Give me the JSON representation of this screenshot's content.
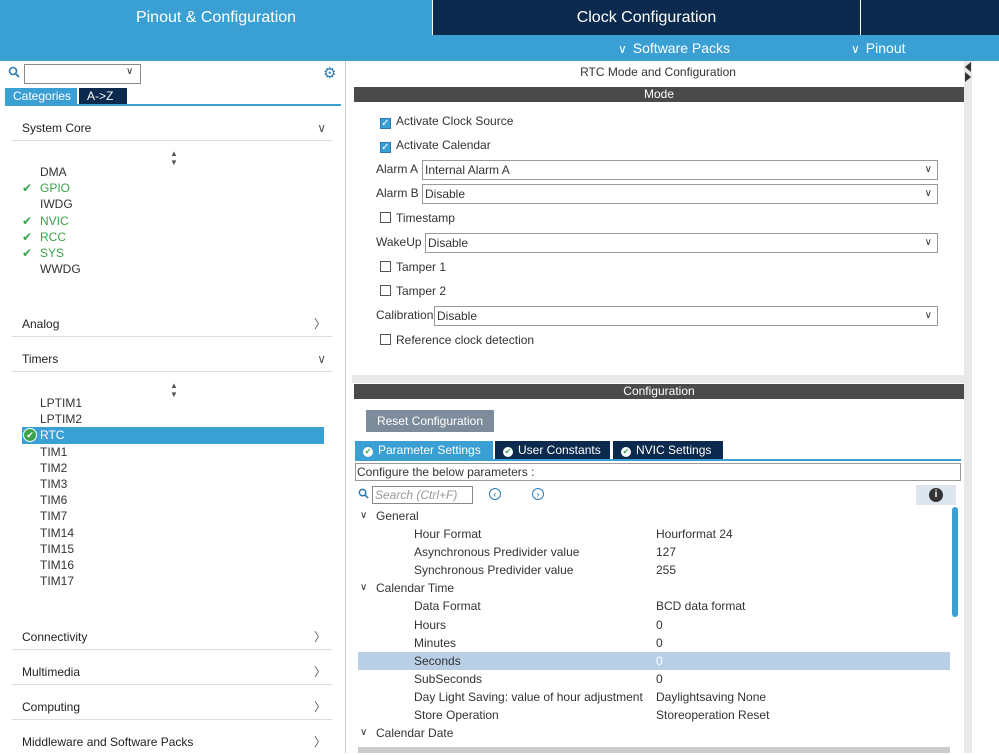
{
  "top_tabs": {
    "pinout": "Pinout & Configuration",
    "clock": "Clock Configuration"
  },
  "sub_bar": {
    "software_packs": "Software Packs",
    "pinout": "Pinout"
  },
  "left_panel": {
    "search_value": "",
    "category_tabs": [
      "Categories",
      "A->Z"
    ],
    "sections": {
      "system_core": "System Core",
      "analog": "Analog",
      "timers": "Timers",
      "connectivity": "Connectivity",
      "multimedia": "Multimedia",
      "computing": "Computing",
      "middleware": "Middleware and Software Packs"
    },
    "system_core_items": [
      {
        "label": "DMA",
        "status": "none"
      },
      {
        "label": "GPIO",
        "status": "ok"
      },
      {
        "label": "IWDG",
        "status": "none"
      },
      {
        "label": "NVIC",
        "status": "ok"
      },
      {
        "label": "RCC",
        "status": "ok"
      },
      {
        "label": "SYS",
        "status": "ok"
      },
      {
        "label": "WWDG",
        "status": "none"
      }
    ],
    "timer_items": [
      {
        "label": "LPTIM1"
      },
      {
        "label": "LPTIM2"
      },
      {
        "label": "RTC",
        "selected": true
      },
      {
        "label": "TIM1"
      },
      {
        "label": "TIM2"
      },
      {
        "label": "TIM3"
      },
      {
        "label": "TIM6"
      },
      {
        "label": "TIM7"
      },
      {
        "label": "TIM14"
      },
      {
        "label": "TIM15"
      },
      {
        "label": "TIM16"
      },
      {
        "label": "TIM17"
      }
    ]
  },
  "right_panel": {
    "title": "RTC Mode and Configuration",
    "mode_header": "Mode",
    "mode": {
      "activate_clock_source": "Activate Clock Source",
      "activate_calendar": "Activate Calendar",
      "alarm_a_label": "Alarm A",
      "alarm_a_value": "Internal Alarm A",
      "alarm_b_label": "Alarm B",
      "alarm_b_value": "Disable",
      "timestamp": "Timestamp",
      "wakeup_label": "WakeUp",
      "wakeup_value": "Disable",
      "tamper1": "Tamper 1",
      "tamper2": "Tamper 2",
      "calibration_label": "Calibration",
      "calibration_value": "Disable",
      "reference_clock": "Reference clock detection"
    },
    "config_header": "Configuration",
    "reset_button": "Reset Configuration",
    "param_tabs": [
      "Parameter Settings",
      "User Constants",
      "NVIC Settings"
    ],
    "configure_text": "Configure the below parameters :",
    "search_placeholder": "Search (Ctrl+F)",
    "tree": {
      "general": "General",
      "hour_format_label": "Hour Format",
      "hour_format_value": "Hourformat 24",
      "async_label": "Asynchronous Predivider value",
      "async_value": "127",
      "sync_label": "Synchronous Predivider value",
      "sync_value": "255",
      "calendar_time": "Calendar Time",
      "data_format_label": "Data Format",
      "data_format_value": "BCD data format",
      "hours_label": "Hours",
      "hours_value": "0",
      "minutes_label": "Minutes",
      "minutes_value": "0",
      "seconds_label": "Seconds",
      "seconds_value": "0",
      "subseconds_label": "SubSeconds",
      "subseconds_value": "0",
      "daylight_label": "Day Light Saving: value of hour adjustment",
      "daylight_value": "Daylightsaving None",
      "store_label": "Store Operation",
      "store_value": "Storeoperation Reset",
      "calendar_date": "Calendar Date"
    }
  },
  "colors": {
    "accent": "#3aa0d4",
    "navy": "#0c2a4d",
    "ok_green": "#3aa34a"
  }
}
